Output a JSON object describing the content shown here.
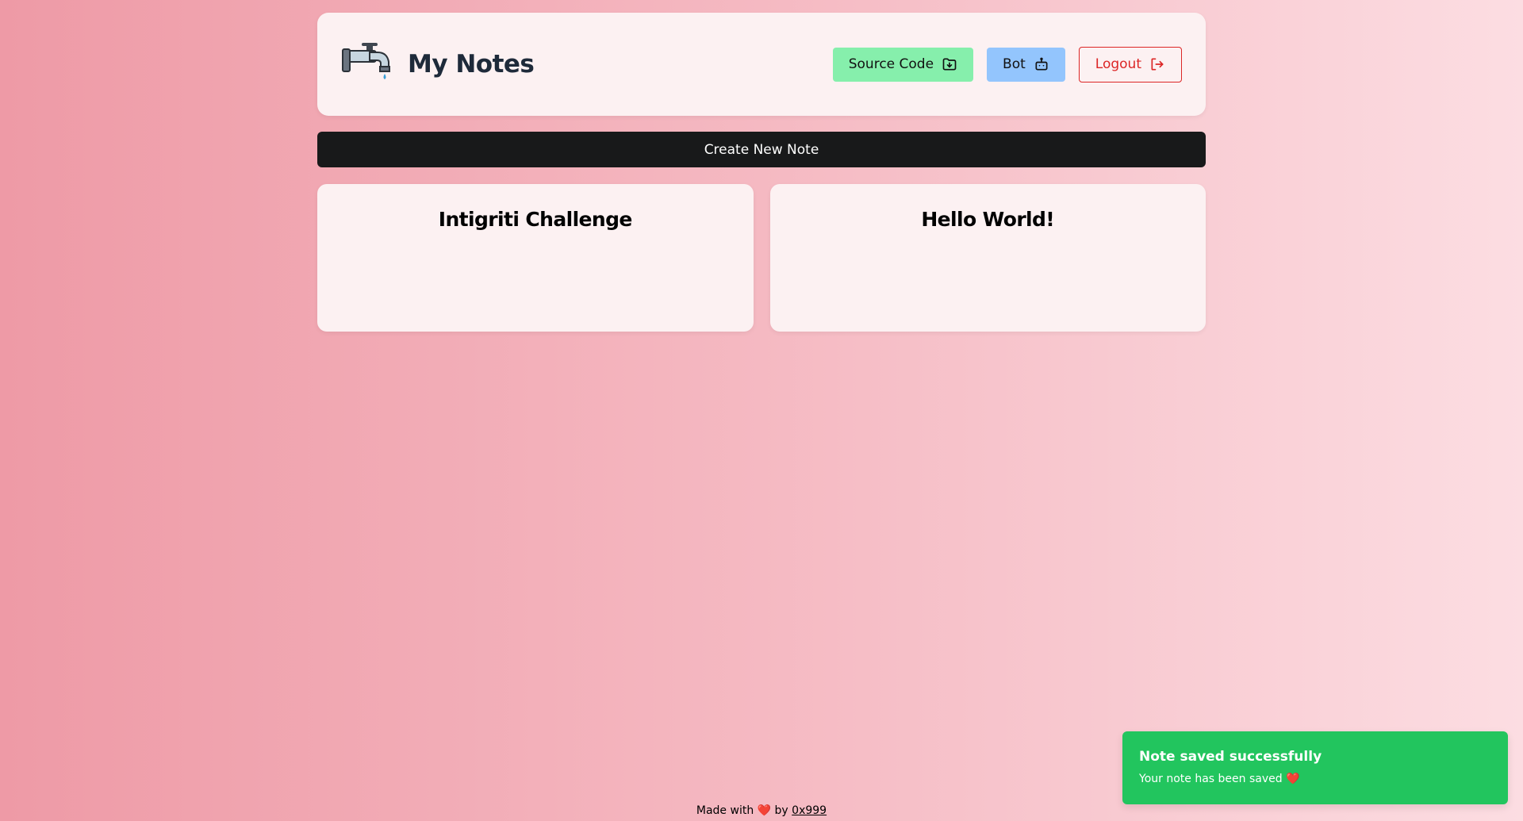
{
  "header": {
    "title": "My Notes",
    "logo_icon": "faucet-icon",
    "buttons": {
      "source_code": "Source Code",
      "bot": "Bot",
      "logout": "Logout"
    }
  },
  "create_button": "Create New Note",
  "notes": [
    {
      "title": "Intigriti Challenge"
    },
    {
      "title": "Hello World!"
    }
  ],
  "footer": {
    "prefix": "Made with",
    "heart": "❤️",
    "by": "by",
    "author": "0x999"
  },
  "toast": {
    "title": "Note saved successfully",
    "message": "Your note has been saved",
    "heart": "❤️"
  },
  "colors": {
    "source_button": "#86efac",
    "bot_button": "#93c5fd",
    "logout_accent": "#dc2626",
    "create_button": "#18191a",
    "toast_success": "#22c55e"
  }
}
